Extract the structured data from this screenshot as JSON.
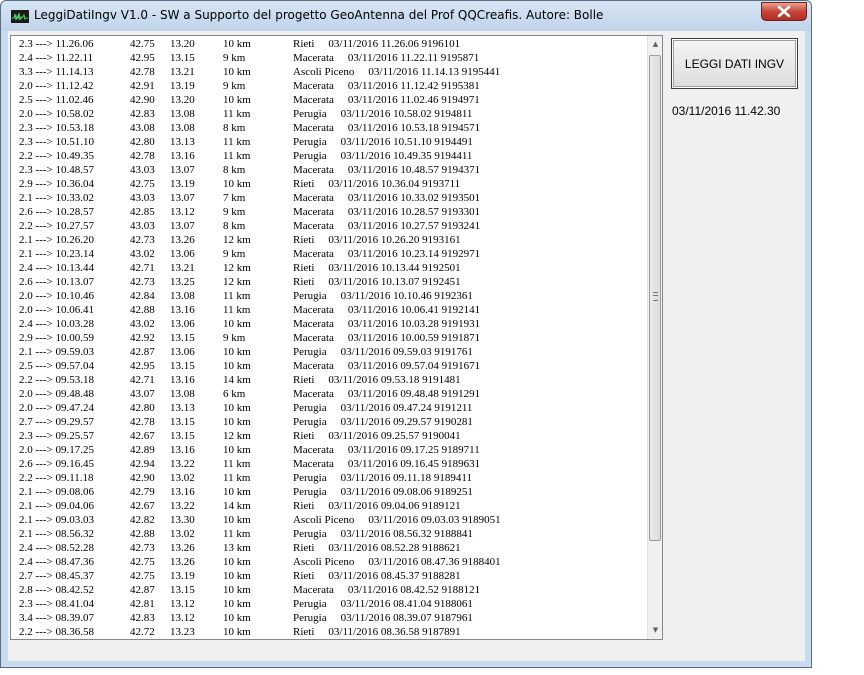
{
  "window": {
    "title": "LeggiDatiIngv V1.0 - SW a Supporto del progetto GeoAntenna del Prof QQCreafis.  Autore: Bolle"
  },
  "read_button": {
    "label": "LEGGI DATI INGV"
  },
  "last_read": "03/11/2016 11.42.30",
  "colors": {
    "close": "#c7453a",
    "titlebar": "#c9dbee",
    "face": "#f0f0f0"
  },
  "icons": {
    "app": "waveform-icon",
    "close": "close-icon"
  },
  "events": [
    {
      "head": "2.3 ---> 11.26.06",
      "lat": "42.75",
      "lon": "13.20",
      "depth": "10 km",
      "place": "Rieti",
      "tail": "03/11/2016 11.26.06 9196101"
    },
    {
      "head": "2.4 ---> 11.22.11",
      "lat": "42.95",
      "lon": "13.15",
      "depth": "9 km",
      "place": "Macerata",
      "tail": "03/11/2016 11.22.11 9195871"
    },
    {
      "head": "3.3 ---> 11.14.13",
      "lat": "42.78",
      "lon": "13.21",
      "depth": "10 km",
      "place": "Ascoli Piceno",
      "tail": "03/11/2016 11.14.13 9195441"
    },
    {
      "head": "2.0 ---> 11.12.42",
      "lat": "42.91",
      "lon": "13.19",
      "depth": "9 km",
      "place": "Macerata",
      "tail": "03/11/2016 11.12.42 9195381"
    },
    {
      "head": "2.5 ---> 11.02.46",
      "lat": "42.90",
      "lon": "13.20",
      "depth": "10 km",
      "place": "Macerata",
      "tail": "03/11/2016 11.02.46 9194971"
    },
    {
      "head": "2.0 ---> 10.58.02",
      "lat": "42.83",
      "lon": "13.08",
      "depth": "11 km",
      "place": "Perugia",
      "tail": "03/11/2016 10.58.02 9194811"
    },
    {
      "head": "2.3 ---> 10.53.18",
      "lat": "43.08",
      "lon": "13.08",
      "depth": "8 km",
      "place": "Macerata",
      "tail": "03/11/2016 10.53.18 9194571"
    },
    {
      "head": "2.3 ---> 10.51.10",
      "lat": "42.80",
      "lon": "13.13",
      "depth": "11 km",
      "place": "Perugia",
      "tail": "03/11/2016 10.51.10 9194491"
    },
    {
      "head": "2.2 ---> 10.49.35",
      "lat": "42.78",
      "lon": "13.16",
      "depth": "11 km",
      "place": "Perugia",
      "tail": "03/11/2016 10.49.35 9194411"
    },
    {
      "head": "2.3 ---> 10.48.57",
      "lat": "43.03",
      "lon": "13.07",
      "depth": "8 km",
      "place": "Macerata",
      "tail": "03/11/2016 10.48.57 9194371"
    },
    {
      "head": "2.9 ---> 10.36.04",
      "lat": "42.75",
      "lon": "13.19",
      "depth": "10 km",
      "place": "Rieti",
      "tail": "03/11/2016 10.36.04 9193711"
    },
    {
      "head": "2.1 ---> 10.33.02",
      "lat": "43.03",
      "lon": "13.07",
      "depth": "7 km",
      "place": "Macerata",
      "tail": "03/11/2016 10.33.02 9193501"
    },
    {
      "head": "2.6 ---> 10.28.57",
      "lat": "42.85",
      "lon": "13.12",
      "depth": "9 km",
      "place": "Macerata",
      "tail": "03/11/2016 10.28.57 9193301"
    },
    {
      "head": "2.2 ---> 10.27.57",
      "lat": "43.03",
      "lon": "13.07",
      "depth": "8 km",
      "place": "Macerata",
      "tail": "03/11/2016 10.27.57 9193241"
    },
    {
      "head": "2.1 ---> 10.26.20",
      "lat": "42.73",
      "lon": "13.26",
      "depth": "12 km",
      "place": "Rieti",
      "tail": "03/11/2016 10.26.20 9193161"
    },
    {
      "head": "2.1 ---> 10.23.14",
      "lat": "43.02",
      "lon": "13.06",
      "depth": "9 km",
      "place": "Macerata",
      "tail": "03/11/2016 10.23.14 9192971"
    },
    {
      "head": "2.4 ---> 10.13.44",
      "lat": "42.71",
      "lon": "13.21",
      "depth": "12 km",
      "place": "Rieti",
      "tail": "03/11/2016 10.13.44 9192501"
    },
    {
      "head": "2.6 ---> 10.13.07",
      "lat": "42.73",
      "lon": "13.25",
      "depth": "12 km",
      "place": "Rieti",
      "tail": "03/11/2016 10.13.07 9192451"
    },
    {
      "head": "2.0 ---> 10.10.46",
      "lat": "42.84",
      "lon": "13.08",
      "depth": "11 km",
      "place": "Perugia",
      "tail": "03/11/2016 10.10.46 9192361"
    },
    {
      "head": "2.0 ---> 10.06.41",
      "lat": "42.88",
      "lon": "13.16",
      "depth": "11 km",
      "place": "Macerata",
      "tail": "03/11/2016 10.06.41 9192141"
    },
    {
      "head": "2.4 ---> 10.03.28",
      "lat": "43.02",
      "lon": "13.06",
      "depth": "10 km",
      "place": "Macerata",
      "tail": "03/11/2016 10.03.28 9191931"
    },
    {
      "head": "2.9 ---> 10.00.59",
      "lat": "42.92",
      "lon": "13.15",
      "depth": "9 km",
      "place": "Macerata",
      "tail": "03/11/2016 10.00.59 9191871"
    },
    {
      "head": "2.1 ---> 09.59.03",
      "lat": "42.87",
      "lon": "13.06",
      "depth": "10 km",
      "place": "Perugia",
      "tail": "03/11/2016 09.59.03 9191761"
    },
    {
      "head": "2.5 ---> 09.57.04",
      "lat": "42.95",
      "lon": "13.15",
      "depth": "10 km",
      "place": "Macerata",
      "tail": "03/11/2016 09.57.04 9191671"
    },
    {
      "head": "2.2 ---> 09.53.18",
      "lat": "42.71",
      "lon": "13.16",
      "depth": "14 km",
      "place": "Rieti",
      "tail": "03/11/2016 09.53.18 9191481"
    },
    {
      "head": "2.0 ---> 09.48.48",
      "lat": "43.07",
      "lon": "13.08",
      "depth": "6 km",
      "place": "Macerata",
      "tail": "03/11/2016 09.48.48 9191291"
    },
    {
      "head": "2.0 ---> 09.47.24",
      "lat": "42.80",
      "lon": "13.13",
      "depth": "10 km",
      "place": "Perugia",
      "tail": "03/11/2016 09.47.24 9191211"
    },
    {
      "head": "2.7 ---> 09.29.57",
      "lat": "42.78",
      "lon": "13.15",
      "depth": "10 km",
      "place": "Perugia",
      "tail": "03/11/2016 09.29.57 9190281"
    },
    {
      "head": "2.3 ---> 09.25.57",
      "lat": "42.67",
      "lon": "13.15",
      "depth": "12 km",
      "place": "Rieti",
      "tail": "03/11/2016 09.25.57 9190041"
    },
    {
      "head": "2.0 ---> 09.17.25",
      "lat": "42.89",
      "lon": "13.16",
      "depth": "10 km",
      "place": "Macerata",
      "tail": "03/11/2016 09.17.25 9189711"
    },
    {
      "head": "2.6 ---> 09.16.45",
      "lat": "42.94",
      "lon": "13.22",
      "depth": "11 km",
      "place": "Macerata",
      "tail": "03/11/2016 09.16.45 9189631"
    },
    {
      "head": "2.2 ---> 09.11.18",
      "lat": "42.90",
      "lon": "13.02",
      "depth": "11 km",
      "place": "Perugia",
      "tail": "03/11/2016 09.11.18 9189411"
    },
    {
      "head": "2.1 ---> 09.08.06",
      "lat": "42.79",
      "lon": "13.16",
      "depth": "10 km",
      "place": "Perugia",
      "tail": "03/11/2016 09.08.06 9189251"
    },
    {
      "head": "2.1 ---> 09.04.06",
      "lat": "42.67",
      "lon": "13.22",
      "depth": "14 km",
      "place": "Rieti",
      "tail": "03/11/2016 09.04.06 9189121"
    },
    {
      "head": "2.1 ---> 09.03.03",
      "lat": "42.82",
      "lon": "13.30",
      "depth": "10 km",
      "place": "Ascoli Piceno",
      "tail": "03/11/2016 09.03.03 9189051"
    },
    {
      "head": "2.1 ---> 08.56.32",
      "lat": "42.88",
      "lon": "13.02",
      "depth": "11 km",
      "place": "Perugia",
      "tail": "03/11/2016 08.56.32 9188841"
    },
    {
      "head": "2.4 ---> 08.52.28",
      "lat": "42.73",
      "lon": "13.26",
      "depth": "13 km",
      "place": "Rieti",
      "tail": "03/11/2016 08.52.28 9188621"
    },
    {
      "head": "2.4 ---> 08.47.36",
      "lat": "42.75",
      "lon": "13.26",
      "depth": "10 km",
      "place": "Ascoli Piceno",
      "tail": "03/11/2016 08.47.36 9188401"
    },
    {
      "head": "2.7 ---> 08.45.37",
      "lat": "42.75",
      "lon": "13.19",
      "depth": "10 km",
      "place": "Rieti",
      "tail": "03/11/2016 08.45.37 9188281"
    },
    {
      "head": "2.8 ---> 08.42.52",
      "lat": "42.87",
      "lon": "13.15",
      "depth": "10 km",
      "place": "Macerata",
      "tail": "03/11/2016 08.42.52 9188121"
    },
    {
      "head": "2.3 ---> 08.41.04",
      "lat": "42.81",
      "lon": "13.12",
      "depth": "10 km",
      "place": "Perugia",
      "tail": "03/11/2016 08.41.04 9188061"
    },
    {
      "head": "3.4 ---> 08.39.07",
      "lat": "42.83",
      "lon": "13.12",
      "depth": "10 km",
      "place": "Perugia",
      "tail": "03/11/2016 08.39.07 9187961"
    },
    {
      "head": "2.2 ---> 08.36.58",
      "lat": "42.72",
      "lon": "13.23",
      "depth": "10 km",
      "place": "Rieti",
      "tail": "03/11/2016 08.36.58 9187891"
    }
  ]
}
